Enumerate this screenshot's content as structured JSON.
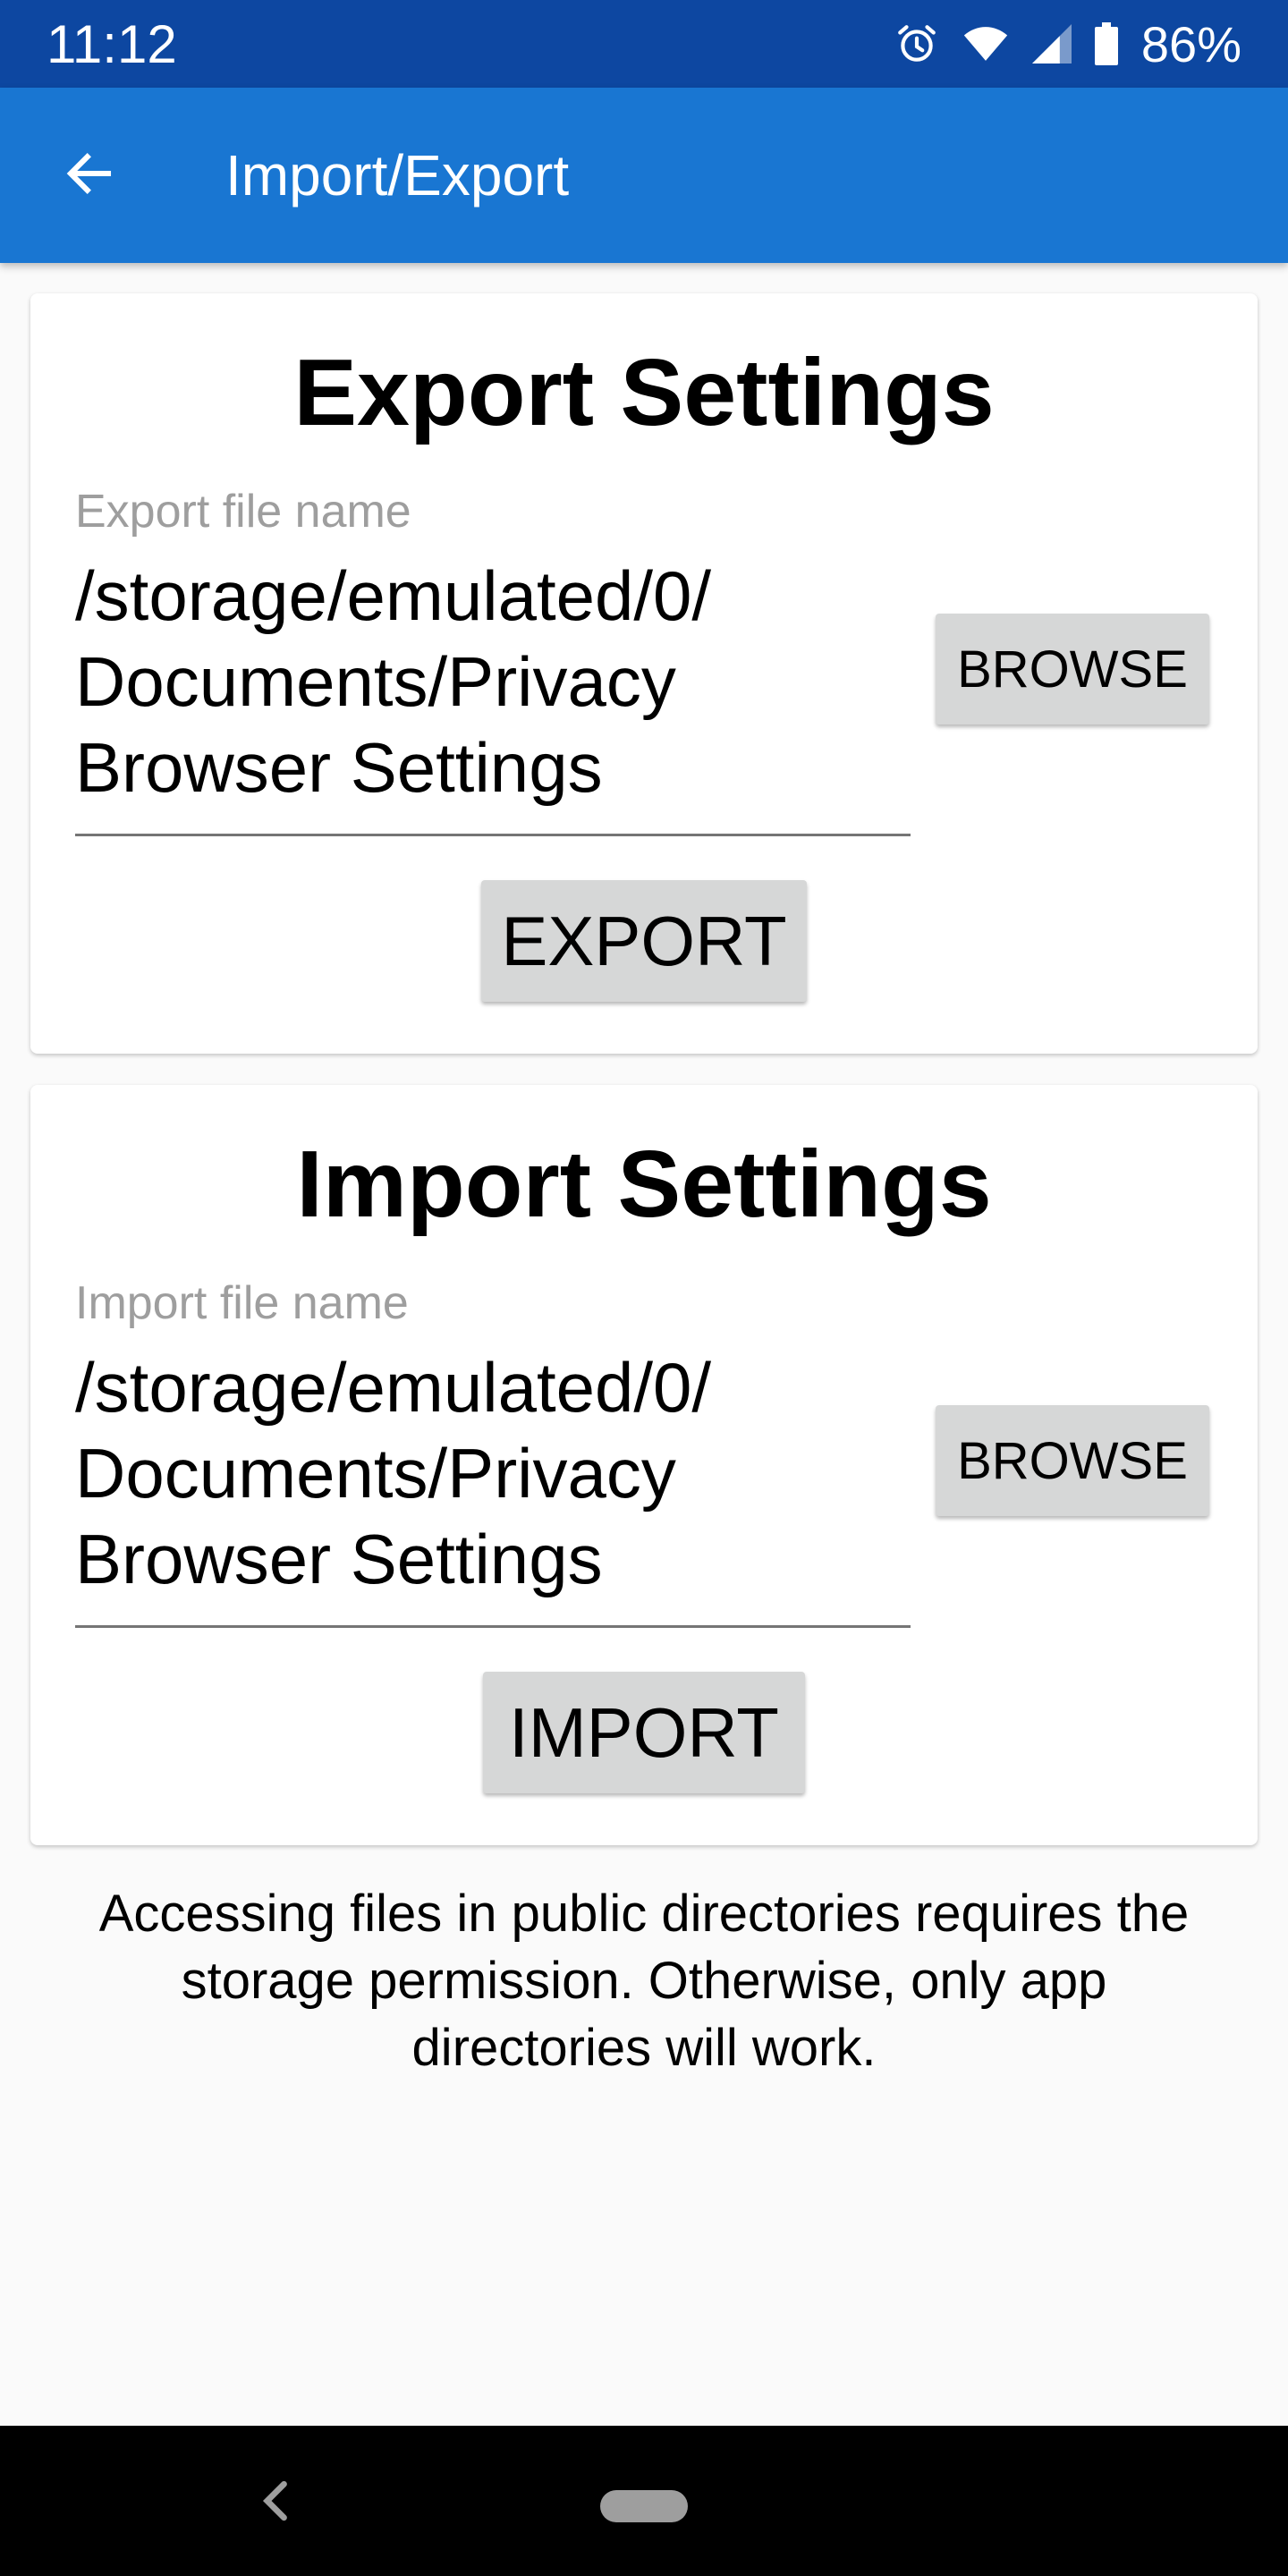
{
  "status_bar": {
    "time": "11:12",
    "battery": "86%",
    "icons": [
      "alarm-icon",
      "wifi-icon",
      "signal-icon",
      "battery-icon"
    ]
  },
  "app_bar": {
    "title": "Import/Export",
    "back_icon": "arrow-back-icon"
  },
  "export_section": {
    "title": "Export Settings",
    "file_label": "Export file name",
    "file_value": "/storage/emulated/0/\nDocuments/Privacy\nBrowser Settings",
    "browse_label": "BROWSE",
    "action_label": "EXPORT"
  },
  "import_section": {
    "title": "Import Settings",
    "file_label": "Import file name",
    "file_value": "/storage/emulated/0/\nDocuments/Privacy\nBrowser Settings",
    "browse_label": "BROWSE",
    "action_label": "IMPORT"
  },
  "permission_note": "Accessing files in public directories requires the storage permission. Otherwise, only app directories will work.",
  "colors": {
    "status_bar": "#0d47a1",
    "app_bar": "#1976d2",
    "background": "#fafafa",
    "button": "#d6d7d7"
  }
}
